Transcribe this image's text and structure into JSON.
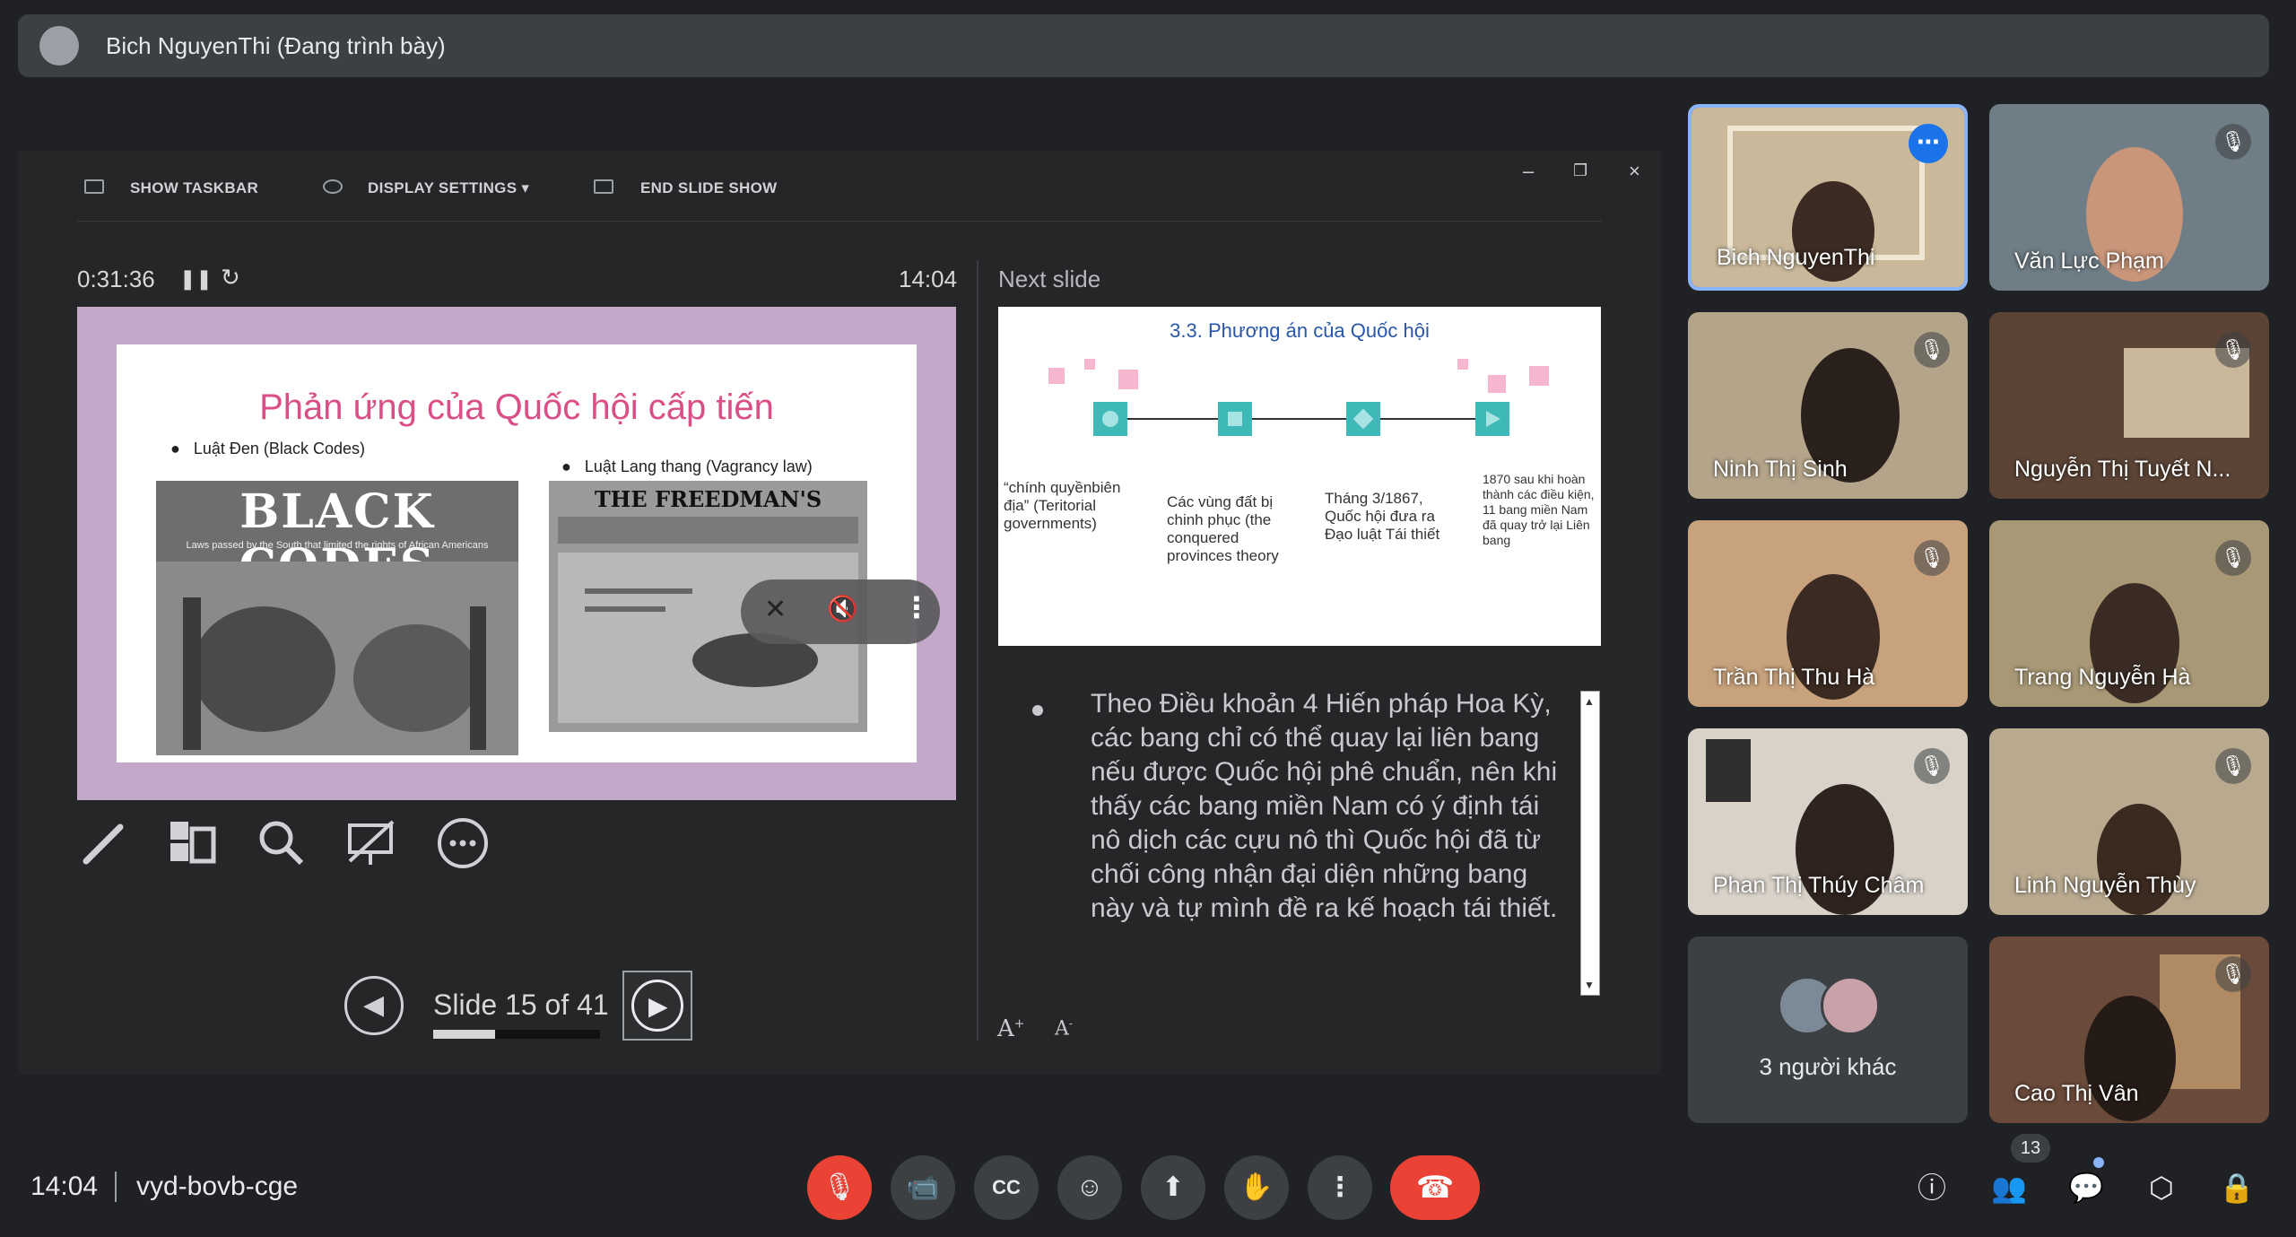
{
  "presenter_bar": {
    "label": "Bich NguyenThi (Đang trình bày)"
  },
  "presenter_toolbar": {
    "show_taskbar": "SHOW TASKBAR",
    "display_settings": "DISPLAY SETTINGS ▾",
    "end_slide_show": "END SLIDE SHOW"
  },
  "presenter_view": {
    "elapsed": "0:31:36",
    "clock": "14:04",
    "next_slide_label": "Next slide",
    "slide_position": "Slide 15 of 41",
    "progress_fraction": 0.37,
    "notes": "Theo Điều khoản 4 Hiến pháp Hoa Kỳ, các bang chỉ có thể quay lại liên bang nếu được Quốc hội phê chuẩn, nên khi thấy các bang miền Nam có ý định tái nô dịch các cựu nô thì Quốc hội đã từ chối công nhận đại diện những bang này và tự mình đề ra kế hoạch tái thiết."
  },
  "current_slide": {
    "title": "Phản ứng của Quốc hội cấp tiến",
    "bullet_left": "Luật Đen (Black Codes)",
    "bullet_right": "Luật Lang thang (Vagrancy law)",
    "black_codes_heading": "BLACK CODES",
    "black_codes_caption": "Laws passed by the South that limited the rights of African Americans",
    "newspaper_heading": "THE FREEDMAN'S BUREAU!"
  },
  "next_slide": {
    "title": "3.3. Phương án của Quốc hội",
    "captions": [
      "“chính quyềnbiên địa” (Teritorial governments)",
      "Các vùng đất bị chinh phục (the conquered provinces theory",
      "Tháng 3/1867, Quốc hội đưa ra Đạo luật Tái thiết",
      "1870 sau khi hoàn thành các điều kiện, 11 bang miền Nam đã quay trở lại Liên bang"
    ]
  },
  "participants": [
    {
      "name": "Bich NguyenThi",
      "bg": "#c9b89a"
    },
    {
      "name": "Văn Lực Phạm",
      "bg": "#6f7d86"
    },
    {
      "name": "Ninh Thị Sinh",
      "bg": "#b4a48a"
    },
    {
      "name": "Nguyễn Thị Tuyết N...",
      "bg": "#5b4436"
    },
    {
      "name": "Trần Thị Thu Hà",
      "bg": "#c7a27c"
    },
    {
      "name": "Trang Nguyễn Hà",
      "bg": "#a89876"
    },
    {
      "name": "Phan Thị Thúy Châm",
      "bg": "#d8d2c8"
    },
    {
      "name": "Linh Nguyễn Thùy",
      "bg": "#b8a98f"
    },
    {
      "name": "Cao Thị Vân",
      "bg": "#6a4a3a"
    }
  ],
  "others_tile": {
    "label": "3 người khác"
  },
  "bottom_bar": {
    "time": "14:04",
    "meeting_code": "vyd-bovb-cge",
    "participant_count": "13"
  },
  "icons": [
    "mic-off-icon",
    "camera-icon",
    "captions-icon",
    "emoji-icon",
    "present-icon",
    "raise-hand-icon",
    "more-options-icon",
    "end-call-icon",
    "info-icon",
    "people-icon",
    "chat-icon",
    "activities-icon",
    "host-controls-icon"
  ],
  "colors": {
    "accent": "#8ab4f8",
    "danger": "#ea4335",
    "slide_title": "#d94f86",
    "next_title": "#2a56a8",
    "node": "#3fb8b8"
  }
}
